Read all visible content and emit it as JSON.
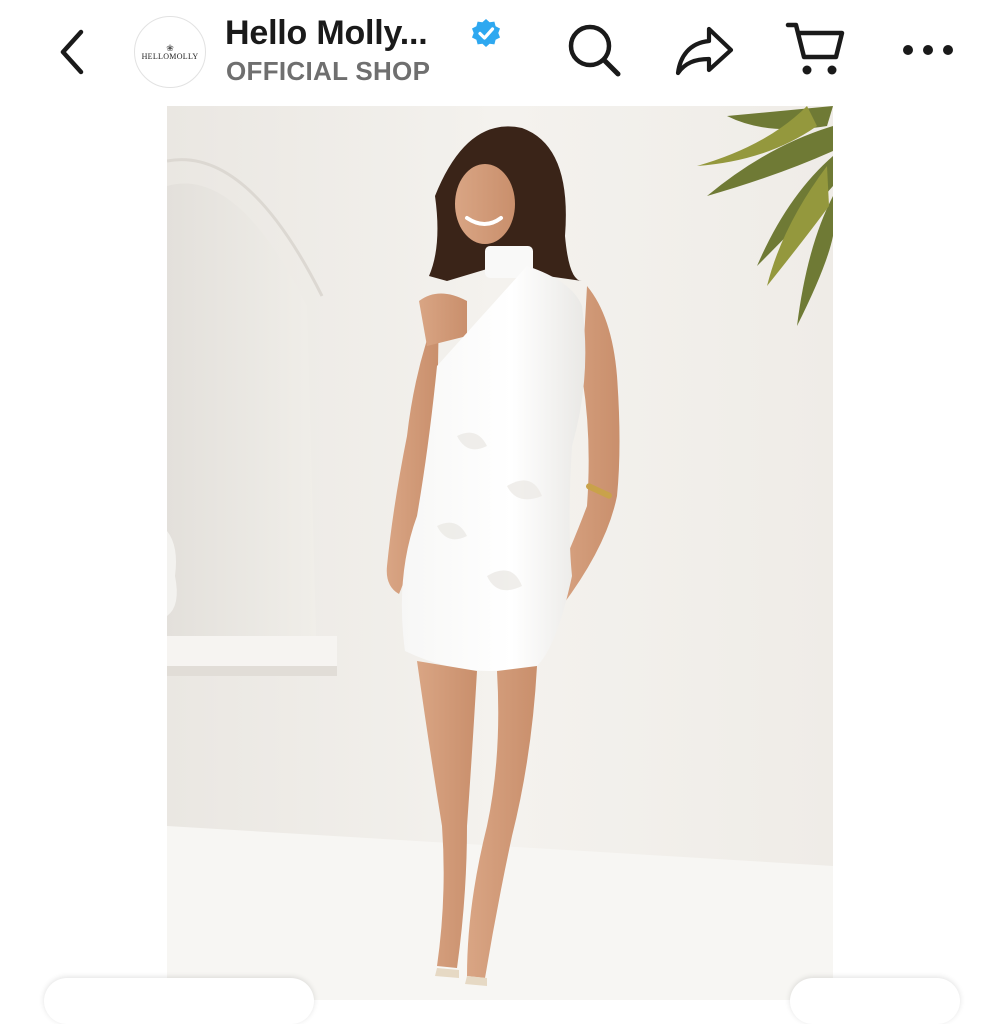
{
  "header": {
    "shop_name": "Hello Molly...",
    "shop_subtitle": "OFFICIAL SHOP",
    "logo_text": "HELLOMOLLY",
    "verified_color": "#2EA8F0",
    "icons": [
      "back-icon",
      "verified-icon",
      "search-icon",
      "share-icon",
      "cart-icon",
      "more-icon"
    ]
  },
  "product_image": {
    "subject": "model wearing white one-shoulder mini dress"
  }
}
